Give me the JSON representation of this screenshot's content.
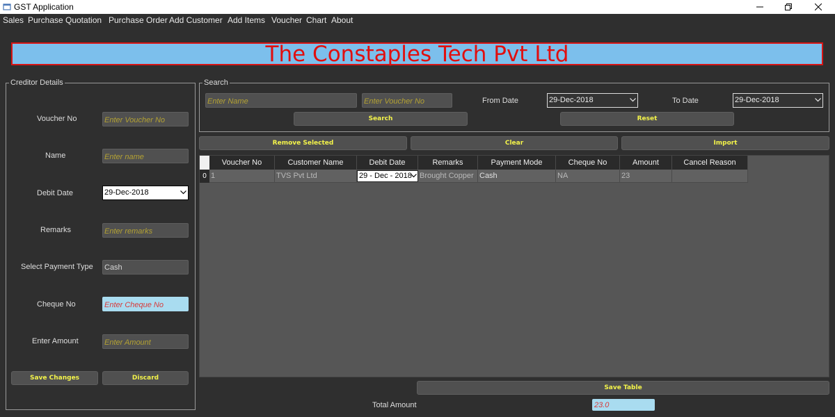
{
  "window": {
    "title": "GST Application"
  },
  "menu": [
    "Sales",
    "Purchase",
    "Quotation",
    "Purchase Order",
    "Add Customer",
    "Add Items",
    "Voucher",
    "Chart",
    "About"
  ],
  "banner": {
    "text": "The Constaples Tech Pvt Ltd"
  },
  "creditor": {
    "title": "Creditor Details",
    "voucher_label": "Voucher No",
    "voucher_placeholder": "Enter Voucher No",
    "name_label": "Name",
    "name_placeholder": "Enter name",
    "debit_label": "Debit Date",
    "debit_value": "29-Dec-2018",
    "remarks_label": "Remarks",
    "remarks_placeholder": "Enter remarks",
    "payment_label": "Select Payment Type",
    "payment_value": "Cash",
    "cheque_label": "Cheque No",
    "cheque_placeholder": "Enter Cheque No",
    "amount_label": "Enter Amount",
    "amount_placeholder": "Enter Amount",
    "save_label": "Save Changes",
    "discard_label": "Discard"
  },
  "search": {
    "title": "Search",
    "name_placeholder": "Enter Name",
    "voucher_placeholder": "Enter Voucher No",
    "from_label": "From Date",
    "from_value": "29-Dec-2018",
    "to_label": "To Date",
    "to_value": "29-Dec-2018",
    "search_label": "Search",
    "reset_label": "Reset"
  },
  "actions": {
    "remove_label": "Remove Selected",
    "clear_label": "Clear",
    "import_label": "Import"
  },
  "table": {
    "columns": [
      "Voucher No",
      "Customer Name",
      "Debit Date",
      "Remarks",
      "Payment Mode",
      "Cheque No",
      "Amount",
      "Cancel Reason"
    ],
    "rows": [
      {
        "index": "0",
        "voucher": "1",
        "customer": "TVS Pvt Ltd",
        "debit_date": "29 - Dec - 2018",
        "remarks": "Brought Copper",
        "payment": "Cash",
        "cheque": "NA",
        "amount": "23",
        "cancel": ""
      }
    ]
  },
  "footer": {
    "save_table_label": "Save Table",
    "total_label": "Total Amount",
    "total_value": "23.0"
  },
  "colors": {
    "banner_bg": "#7cbfec",
    "banner_text": "#e10f0f",
    "button_text": "#f4f44a",
    "placeholder": "#b3a133",
    "total_bg": "#a9dcf0"
  }
}
